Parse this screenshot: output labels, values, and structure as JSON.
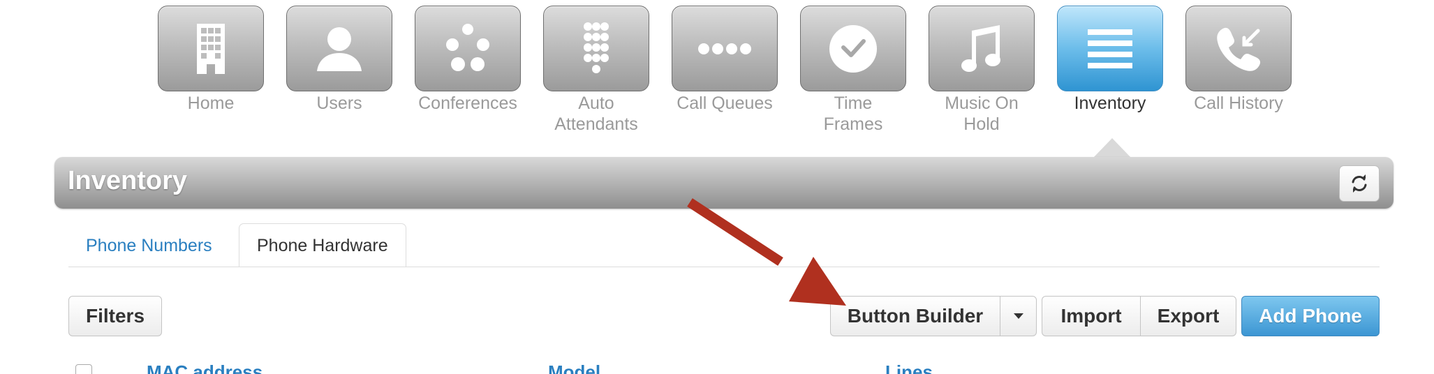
{
  "nav": {
    "items": [
      {
        "label": "Home",
        "icon": "building-icon"
      },
      {
        "label": "Users",
        "icon": "user-icon"
      },
      {
        "label": "Conferences",
        "icon": "conference-icon"
      },
      {
        "label": "Auto\nAttendants",
        "icon": "keypad-icon"
      },
      {
        "label": "Call Queues",
        "icon": "queue-dots-icon"
      },
      {
        "label": "Time\nFrames",
        "icon": "clock-icon"
      },
      {
        "label": "Music On\nHold",
        "icon": "music-note-icon"
      },
      {
        "label": "Inventory",
        "icon": "list-icon",
        "active": true
      },
      {
        "label": "Call History",
        "icon": "call-history-icon"
      }
    ]
  },
  "panel": {
    "title": "Inventory",
    "refresh_icon": "refresh-icon"
  },
  "tabs": [
    {
      "label": "Phone Numbers"
    },
    {
      "label": "Phone Hardware",
      "active": true
    }
  ],
  "toolbar": {
    "filters": "Filters",
    "button_builder": "Button Builder",
    "import": "Import",
    "export": "Export",
    "add_phone": "Add Phone"
  },
  "table": {
    "columns": [
      "MAC address",
      "Model",
      "Lines"
    ]
  },
  "colors": {
    "accent_blue": "#2a7fc0",
    "active_tile": "#6cbdea",
    "annotation_arrow": "#b0301f"
  }
}
